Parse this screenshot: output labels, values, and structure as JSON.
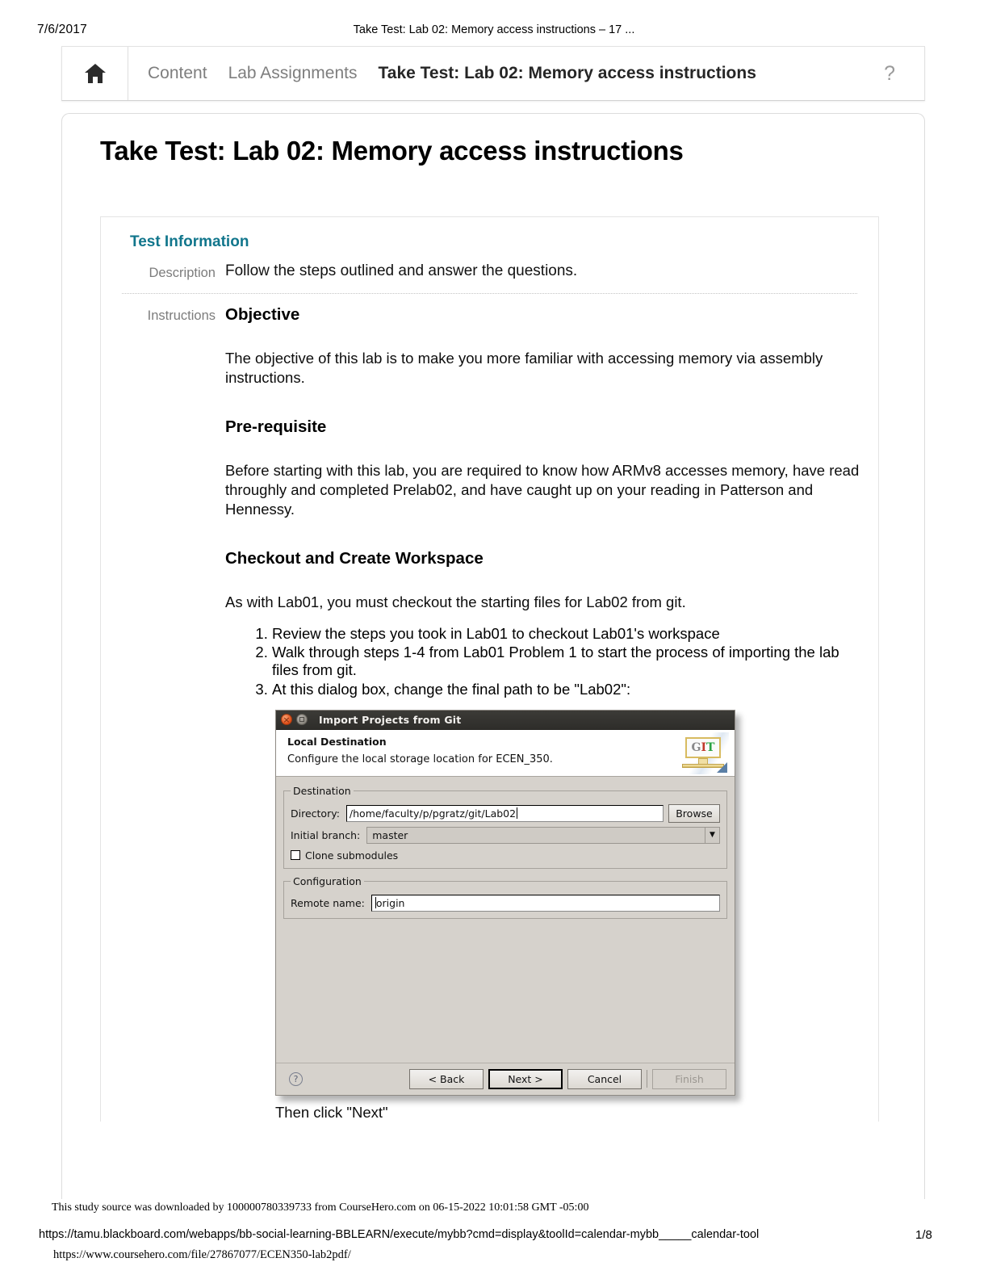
{
  "print_header": {
    "date": "7/6/2017",
    "title": "Take Test: Lab 02: Memory access instructions – 17 ..."
  },
  "breadcrumb": {
    "home_icon": "home-icon",
    "links": [
      "Content",
      "Lab Assignments"
    ],
    "current": "Take Test: Lab 02: Memory access instructions",
    "help_icon": "?"
  },
  "page": {
    "title": "Take Test: Lab 02: Memory access instructions"
  },
  "test_information": {
    "heading": "Test Information",
    "heading_color": "#11768c",
    "description_label": "Description",
    "description_text": "Follow the steps outlined and answer the questions.",
    "instructions_label": "Instructions",
    "objective_heading": "Objective",
    "objective_text": "The objective of this lab is to make you more familiar with accessing memory via assembly instructions.",
    "prerequisite_heading": "Pre-requisite",
    "prerequisite_text": "Before starting with this lab, you are required to know how ARMv8 accesses memory, have read throughly and completed Prelab02, and have caught up on your reading in Patterson and Hennessy.",
    "checkout_heading": "Checkout and Create Workspace",
    "checkout_text": "As with Lab01, you must checkout the starting files for Lab02 from git.",
    "steps": [
      "Review the steps you took in Lab01 to checkout Lab01's workspace",
      "Walk through steps 1-4 from Lab01 Problem 1 to start the process of importing the lab files from git.",
      "At this dialog box, change the final path to be \"Lab02\":"
    ],
    "after_dialog_text": "Then click \"Next\""
  },
  "git_dialog": {
    "window_title": "Import Projects from Git",
    "close_icon": "×",
    "maximize_icon": "maximize-icon",
    "logo_text": {
      "g": "G",
      "i": "I",
      "t": "T"
    },
    "header_title": "Local Destination",
    "header_subtitle": "Configure the local storage location for ECEN_350.",
    "destination_group": "Destination",
    "directory_label": "Directory:",
    "directory_value": "/home/faculty/p/pgratz/git/Lab02",
    "browse_button": "Browse",
    "branch_label": "Initial branch:",
    "branch_value": "master",
    "clone_submodules_label": "Clone submodules",
    "clone_submodules_checked": false,
    "configuration_group": "Configuration",
    "remote_label": "Remote name:",
    "remote_value": "origin",
    "help_button": "?",
    "buttons": {
      "back": "< Back",
      "next": "Next >",
      "cancel": "Cancel",
      "finish": "Finish"
    }
  },
  "footer": {
    "coursehero_note": "This study source was downloaded by 100000780339733 from CourseHero.com on 06-15-2022 10:01:58 GMT -05:00",
    "url": "https://tamu.blackboard.com/webapps/bb-social-learning-BBLEARN/execute/mybb?cmd=display&toolId=calendar-mybb_____calendar-tool",
    "page_number": "1/8",
    "coursehero_url": "https://www.coursehero.com/file/27867077/ECEN350-lab2pdf/"
  }
}
